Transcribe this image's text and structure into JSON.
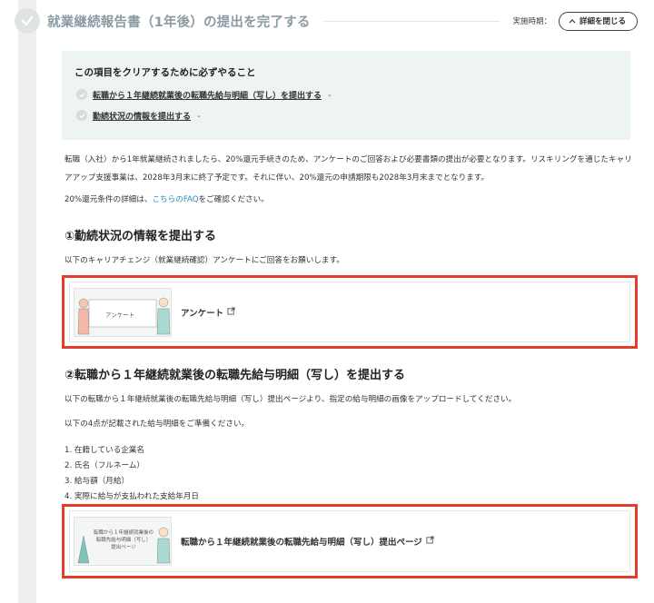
{
  "header": {
    "title": "就業継続報告書（1年後）の提出を完了する",
    "timing_label": "実施時期：",
    "close_button": "詳細を閉じる"
  },
  "todo": {
    "heading": "この項目をクリアするために必ずやること",
    "items": [
      {
        "label": "転職から１年継続就業後の転職先給与明細（写し）を提出する"
      },
      {
        "label": "勤続状況の情報を提出する"
      }
    ]
  },
  "intro": {
    "text": "転職（入社）から1年就業継続されましたら、20%還元手続きのため、アンケートのご回答および必要書類の提出が必要となります。リスキリングを通じたキャリアアップ支援事業は、2028年3月末に終了予定です。それに伴い、20%還元の申請期限も2028年3月末までとなります。",
    "faq_prefix": "20%還元条件の詳細は、",
    "faq_link": "こちらのFAQ",
    "faq_suffix": "をご確認ください。"
  },
  "section1": {
    "title": "①勤続状況の情報を提出する",
    "description": "以下のキャリアチェンジ（就業継続確認）アンケートにご回答をお願いします。",
    "card": {
      "thumbnail_text": "アンケート",
      "label": "アンケート"
    }
  },
  "section2": {
    "title": "②転職から１年継続就業後の転職先給与明細（写し）を提出する",
    "description": "以下の転職から１年継続就業後の転職先給与明細（写し）提出ページより、指定の給与明細の画像をアップロードしてください。",
    "prep": "以下の4点が記載された給与明細をご準備ください。",
    "list": [
      "1. 在籍している企業名",
      "2. 氏名（フルネーム）",
      "3. 給与額（月給）",
      "4. 実際に給与が支払われた支給年月日"
    ],
    "card": {
      "thumbnail_lines": [
        "転職から１年継続就業後の",
        "転職先給与明細（写し）",
        "提出ページ"
      ],
      "label": "転職から１年継続就業後の転職先給与明細（写し）提出ページ"
    }
  },
  "colors": {
    "accent_red": "#e53c2c",
    "link": "#2a8bbf",
    "todo_bg": "#eef4f2"
  }
}
